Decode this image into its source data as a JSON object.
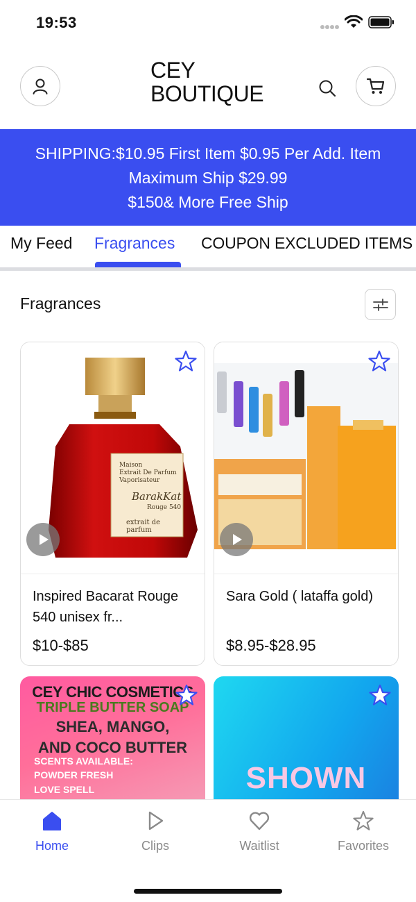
{
  "status_bar": {
    "time": "19:53"
  },
  "header": {
    "brand_line1": "CEY",
    "brand_line2": "BOUTIQUE",
    "icons": {
      "account": "user-icon",
      "search": "search-icon",
      "cart": "cart-icon"
    }
  },
  "banner": {
    "line1": "SHIPPING:$10.95 First Item $0.95  Per Add. Item",
    "line2": "Maximum Ship $29.99",
    "line3": "$150& More Free Ship",
    "background": "#3a4ef0"
  },
  "tabs": [
    {
      "label": "My Feed",
      "active": false
    },
    {
      "label": "Fragrances",
      "active": true
    },
    {
      "label": "COUPON EXCLUDED ITEMS",
      "active": false
    }
  ],
  "section": {
    "title": "Fragrances",
    "filter_icon": "sliders-icon"
  },
  "products": [
    {
      "name": "Inspired Bacarat Rouge 540 unisex fr...",
      "price": "$10-$85",
      "has_video": true,
      "image_label_lines": [
        "Maison",
        "Extrait De Parfum",
        "Vaporisateur",
        "BarakKat",
        "Rouge 540",
        "extrait de parfum"
      ]
    },
    {
      "name": "Sara Gold ( lataffa gold)",
      "price": "$8.95-$28.95",
      "has_video": true
    },
    {
      "promo_lines": [
        "CEY CHIC COSMETICS",
        "TRIPLE BUTTER SOAP",
        "SHEA, MANGO,",
        "AND COCO BUTTER",
        "SCENTS AVAILABLE:",
        "POWDER FRESH",
        "LOVE SPELL"
      ]
    },
    {
      "promo_text": "SHOWN"
    }
  ],
  "bottom_nav": [
    {
      "label": "Home",
      "icon": "home-icon",
      "active": true
    },
    {
      "label": "Clips",
      "icon": "play-icon",
      "active": false
    },
    {
      "label": "Waitlist",
      "icon": "heart-icon",
      "active": false
    },
    {
      "label": "Favorites",
      "icon": "star-icon",
      "active": false
    }
  ],
  "colors": {
    "accent": "#3a4ef0",
    "text": "#111111",
    "muted": "#8a8a8a"
  }
}
